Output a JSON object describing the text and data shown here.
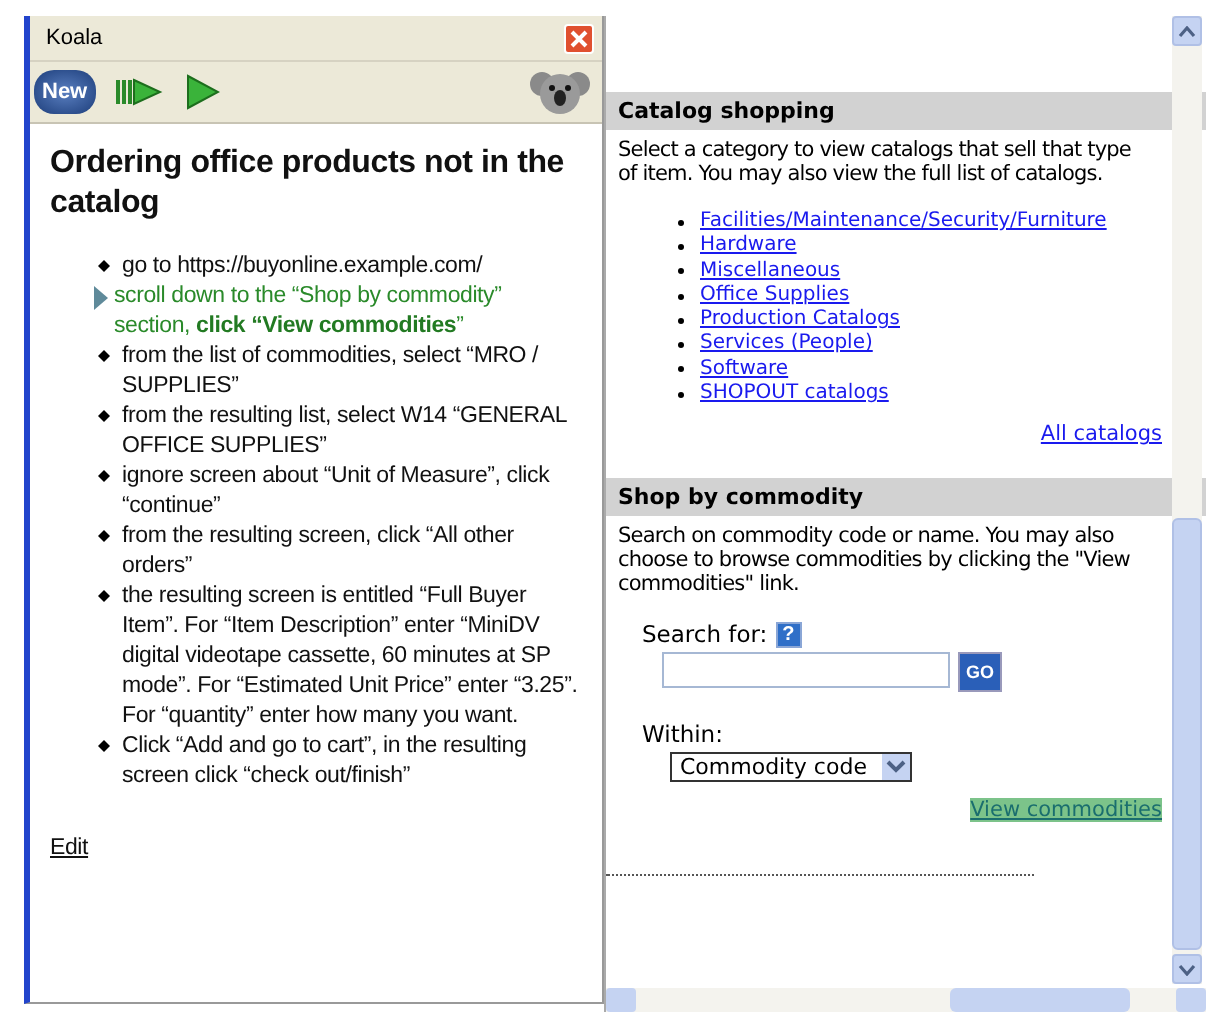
{
  "window": {
    "title": "Koala"
  },
  "toolbar": {
    "new_label": "New"
  },
  "script": {
    "title": "Ordering office products not in the catalog",
    "steps": [
      {
        "kind": "bullet",
        "text": "go to https://buyonline.example.com/"
      },
      {
        "kind": "current",
        "text": "scroll down to the “Shop by commodity” section, **click “View commodities**”"
      },
      {
        "kind": "bullet",
        "text": "from the list of commodities, select “MRO / SUPPLIES”"
      },
      {
        "kind": "bullet",
        "text": "from the resulting list, select W14 “GENERAL OFFICE SUPPLIES”"
      },
      {
        "kind": "bullet",
        "text": "ignore screen about “Unit of Measure”, click “continue”"
      },
      {
        "kind": "bullet",
        "text": "from the resulting screen, click “All other orders”"
      },
      {
        "kind": "bullet",
        "text": "the resulting screen is entitled “Full Buyer Item”. For “Item Description” enter “MiniDV digital videotape cassette, 60 minutes at SP mode”. For “Estimated Unit Price” enter “3.25”. For “quantity” enter how many you want."
      },
      {
        "kind": "bullet",
        "text": "Click “Add and go to cart”, in the resulting screen click “check out/finish”"
      }
    ],
    "edit_link": "Edit"
  },
  "catalog_shopping": {
    "heading": "Catalog shopping",
    "description": "Select a category to view catalogs that sell that type of item. You may also view the full list of catalogs.",
    "categories": [
      "Facilities/Maintenance/Security/Furniture",
      "Hardware",
      "Miscellaneous",
      "Office Supplies",
      "Production Catalogs",
      "Services (People)",
      "Software",
      "SHOPOUT catalogs"
    ],
    "all_link": "All catalogs"
  },
  "shop_by_commodity": {
    "heading": "Shop by commodity",
    "description": "Search on commodity code or name. You may also choose to browse commodities by clicking the \"View commodities\" link.",
    "search_label": "Search for:",
    "help": "?",
    "go_button": "GO",
    "within_label": "Within:",
    "within_value": "Commodity code",
    "view_link": {
      "text": "View commodities",
      "highlighted": true
    }
  }
}
